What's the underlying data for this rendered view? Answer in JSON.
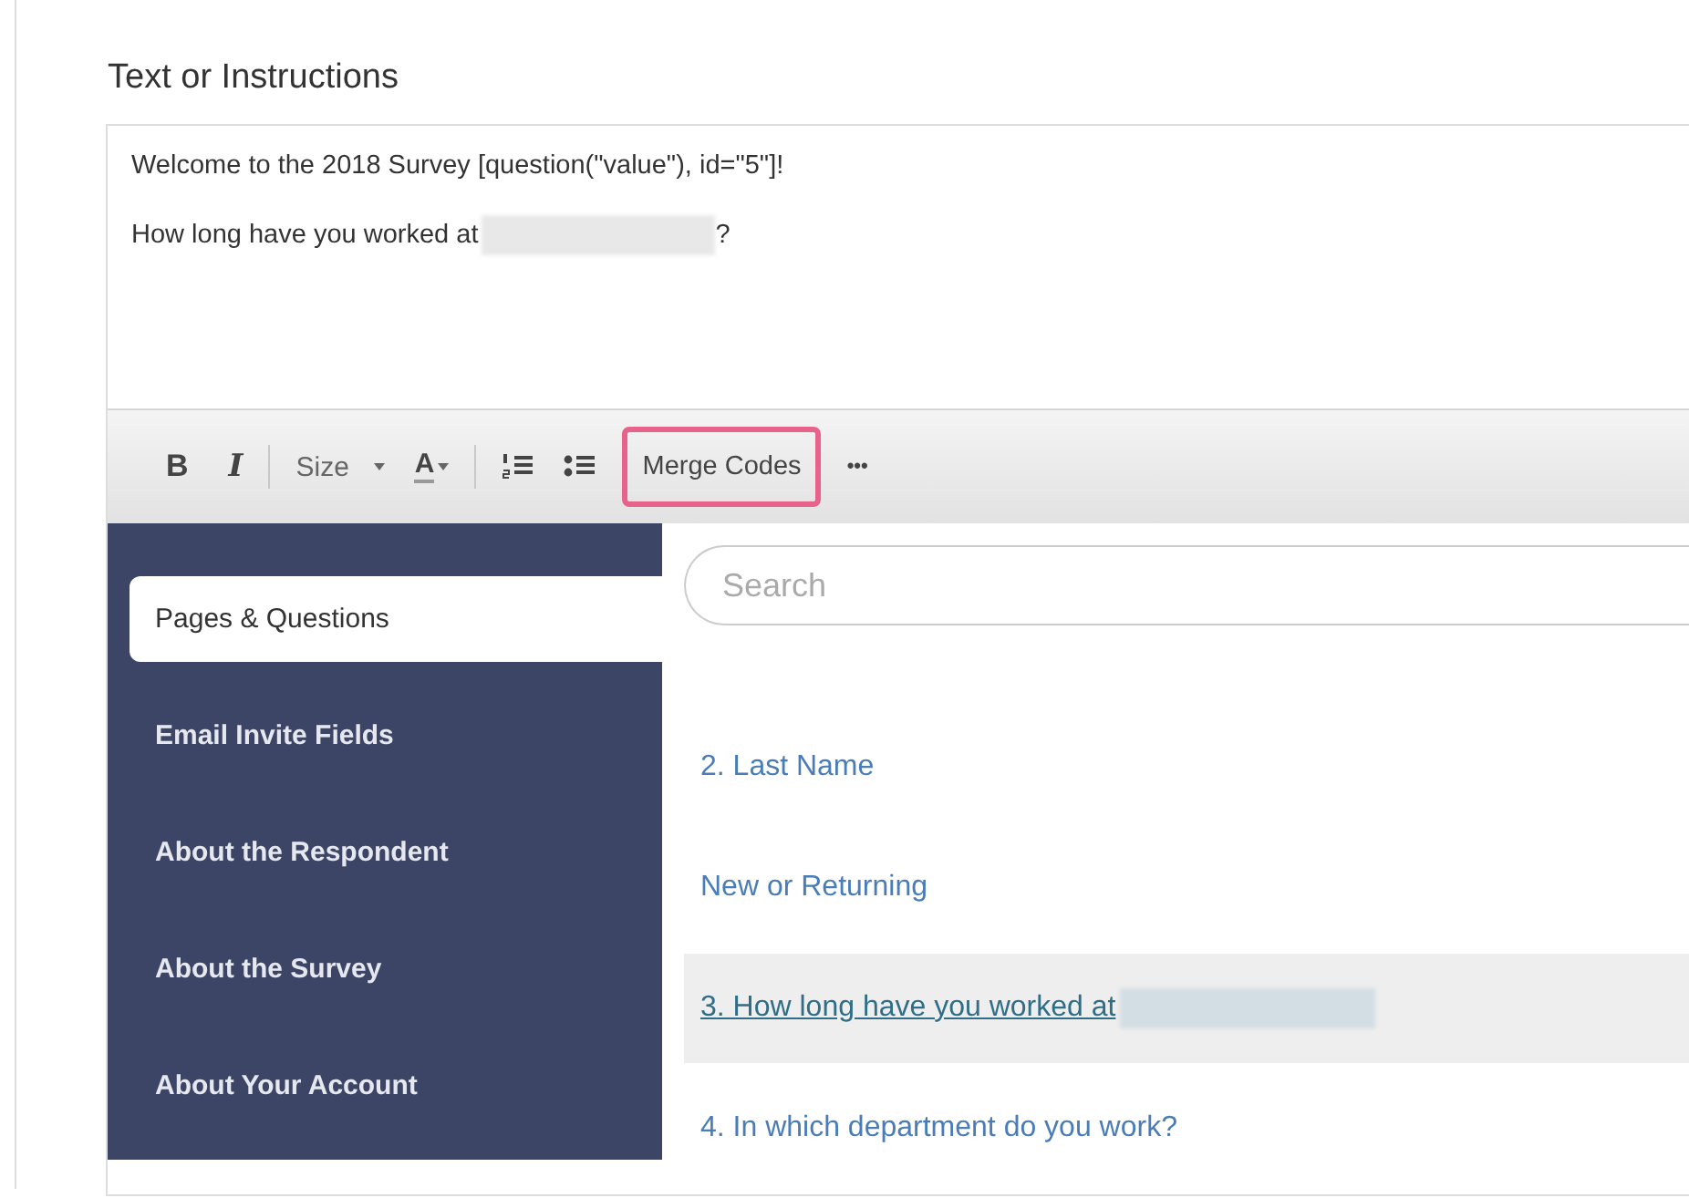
{
  "section_title": "Text or Instructions",
  "editor": {
    "lines": [
      {
        "text": "Welcome to the 2018 Survey [question(\"value\"), id=\"5\"]!"
      },
      {
        "text": "How long have you worked at",
        "redacted": true,
        "after": "?"
      }
    ]
  },
  "toolbar": [
    {
      "kind": "bold",
      "label": "B"
    },
    {
      "kind": "italic",
      "label": "I"
    },
    {
      "kind": "separator"
    },
    {
      "kind": "dropdown",
      "label": "Size"
    },
    {
      "kind": "color",
      "label": "A"
    },
    {
      "kind": "separator"
    },
    {
      "kind": "ordered-list"
    },
    {
      "kind": "bullet-list"
    },
    {
      "kind": "text",
      "label": "Merge Codes",
      "highlighted": true
    },
    {
      "kind": "more",
      "label": "•••"
    }
  ],
  "sidebar": {
    "items": [
      {
        "label": "Pages & Questions",
        "selected": true
      },
      {
        "label": "Email Invite Fields",
        "selected": false
      },
      {
        "label": "About the Respondent",
        "selected": false
      },
      {
        "label": "About the Survey",
        "selected": false
      },
      {
        "label": "About Your Account",
        "selected": false
      }
    ]
  },
  "search": {
    "placeholder": "Search"
  },
  "questions": [
    {
      "label": "2. Last Name",
      "selected": false,
      "redacted": false
    },
    {
      "label": "New or Returning",
      "selected": false,
      "redacted": false
    },
    {
      "label": "3. How long have you worked at",
      "selected": true,
      "redacted": true
    },
    {
      "label": "4. In which department do you work?",
      "selected": false,
      "redacted": false
    }
  ]
}
